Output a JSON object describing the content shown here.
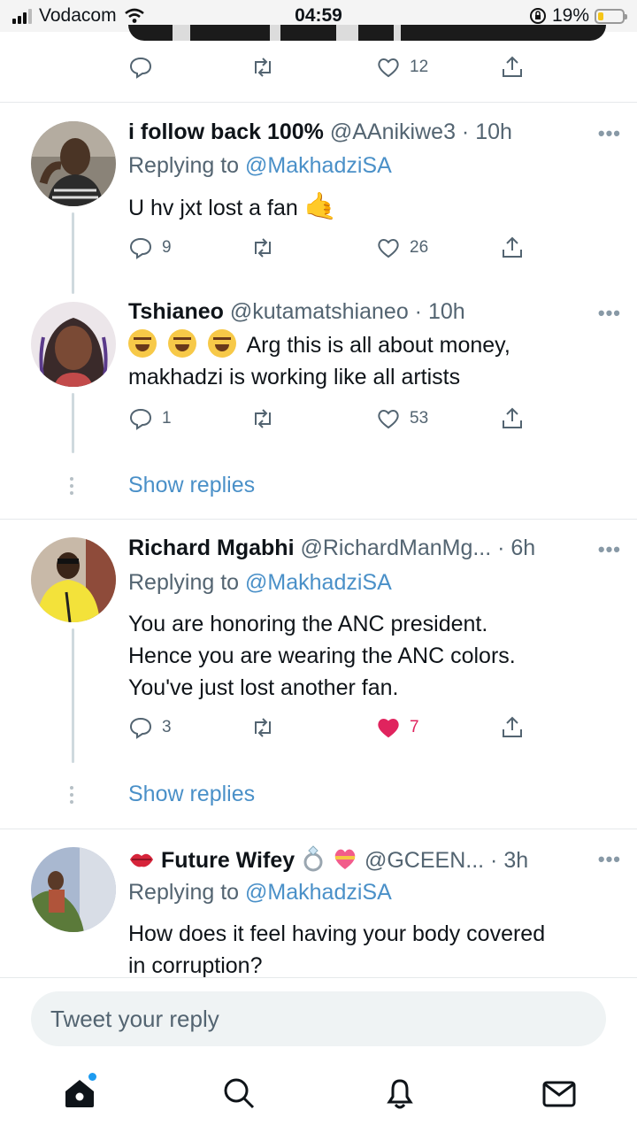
{
  "status_bar": {
    "carrier": "Vodacom",
    "time": "04:59",
    "battery": "19%",
    "battery_level": 0.19
  },
  "top_tweet_actions": {
    "likes": "12"
  },
  "tweets": [
    {
      "name": "i follow back 100%",
      "handle": "@AAnikiwe3 · 10h",
      "replying_prefix": "Replying to ",
      "replying_to": "@MakhadziSA",
      "text": "U hv jxt lost a fan",
      "text_emoji": "🤙",
      "replies": "9",
      "likes": "26"
    },
    {
      "name": "Tshianeo",
      "handle": "@kutamatshianeo · 10h",
      "text_line1": "Arg this is all about money,",
      "text_line2": "makhadzi is working like all artists",
      "replies": "1",
      "likes": "53",
      "show_replies": "Show replies"
    },
    {
      "name": "Richard Mgabhi",
      "handle": "@RichardManMg... · 6h",
      "replying_prefix": "Replying to ",
      "replying_to": "@MakhadziSA",
      "text_line1": "You are honoring the ANC president.",
      "text_line2": "Hence you are wearing the ANC colors.",
      "text_line3": "You've just lost another fan.",
      "replies": "3",
      "likes": "7",
      "liked": true,
      "show_replies": "Show replies"
    },
    {
      "name": "Future Wifey",
      "handle": "@GCEEN... · 3h",
      "replying_prefix": "Replying to ",
      "replying_to": "@MakhadziSA",
      "text_line1": "How does it feel having your body covered",
      "text_line2": "in corruption?"
    }
  ],
  "reply_input": {
    "placeholder": "Tweet your reply"
  },
  "tabs": [
    "home-icon",
    "search-icon",
    "notifications-icon",
    "messages-icon"
  ],
  "colors": {
    "link": "#4a90c8",
    "like_active": "#e0245e",
    "muted": "#536471"
  }
}
